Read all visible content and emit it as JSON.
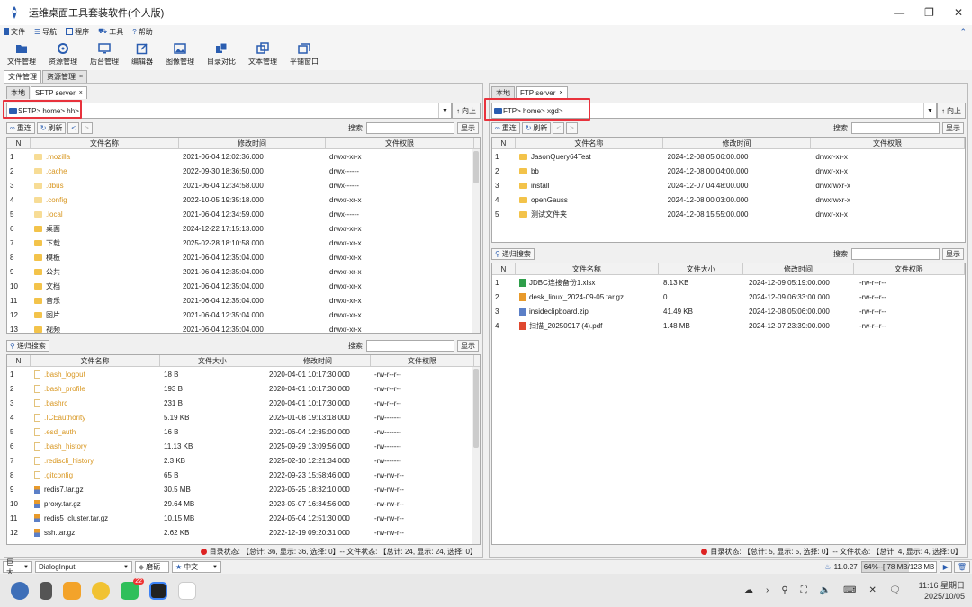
{
  "app": {
    "title": "运维桌面工具套装软件(个人版)",
    "brand_color": "#2a5db0"
  },
  "menu": [
    {
      "label": "文件",
      "icon": "file-icon"
    },
    {
      "label": "导航",
      "icon": "menu-icon"
    },
    {
      "label": "程序",
      "icon": "app-icon"
    },
    {
      "label": "工具",
      "icon": "tool-icon"
    },
    {
      "label": "帮助",
      "icon": "help-icon"
    }
  ],
  "toolbar": [
    {
      "label": "文件管理",
      "icon": "folder-open-icon"
    },
    {
      "label": "资源管理",
      "icon": "resource-icon"
    },
    {
      "label": "后台管理",
      "icon": "monitor-icon"
    },
    {
      "label": "编辑器",
      "icon": "edit-icon"
    },
    {
      "label": "图像管理",
      "icon": "image-icon"
    },
    {
      "label": "目录对比",
      "icon": "compare-icon"
    },
    {
      "label": "文本管理",
      "icon": "text-icon"
    },
    {
      "label": "平铺窗口",
      "icon": "tile-icon"
    }
  ],
  "main_tabs": [
    {
      "label": "文件管理",
      "active": true
    },
    {
      "label": "资源管理",
      "active": false,
      "close": "×"
    }
  ],
  "common": {
    "search": "搜索",
    "show": "显示",
    "up": "向上",
    "refresh_ctx": "重连",
    "refresh": "刷新",
    "recursive": "递归搜索",
    "col_n": "N",
    "col_name": "文件名称",
    "col_time": "修改时间",
    "col_perm": "文件权限",
    "col_size": "文件大小",
    "close": "×",
    "back": "<",
    "fwd": ">",
    "up_arrow": "↑",
    "dd_arrow": "▼"
  },
  "left": {
    "subtabs": [
      {
        "label": "本地"
      },
      {
        "label": "SFTP server",
        "close": "×"
      }
    ],
    "path": [
      "SFTP",
      "home",
      "hh"
    ],
    "dirs": [
      {
        "n": "1",
        "name": ".mozilla",
        "time": "2021-06-04 12:02:36.000",
        "perm": "drwxr-xr-x",
        "hidden": true
      },
      {
        "n": "2",
        "name": ".cache",
        "time": "2022-09-30 18:36:50.000",
        "perm": "drwx------",
        "hidden": true
      },
      {
        "n": "3",
        "name": ".dbus",
        "time": "2021-06-04 12:34:58.000",
        "perm": "drwx------",
        "hidden": true
      },
      {
        "n": "4",
        "name": ".config",
        "time": "2022-10-05 19:35:18.000",
        "perm": "drwxr-xr-x",
        "hidden": true
      },
      {
        "n": "5",
        "name": ".local",
        "time": "2021-06-04 12:34:59.000",
        "perm": "drwx------",
        "hidden": true
      },
      {
        "n": "6",
        "name": "桌面",
        "time": "2024-12-22 17:15:13.000",
        "perm": "drwxr-xr-x",
        "hidden": false
      },
      {
        "n": "7",
        "name": "下载",
        "time": "2025-02-28 18:10:58.000",
        "perm": "drwxr-xr-x",
        "hidden": false
      },
      {
        "n": "8",
        "name": "模板",
        "time": "2021-06-04 12:35:04.000",
        "perm": "drwxr-xr-x",
        "hidden": false
      },
      {
        "n": "9",
        "name": "公共",
        "time": "2021-06-04 12:35:04.000",
        "perm": "drwxr-xr-x",
        "hidden": false
      },
      {
        "n": "10",
        "name": "文档",
        "time": "2021-06-04 12:35:04.000",
        "perm": "drwxr-xr-x",
        "hidden": false
      },
      {
        "n": "11",
        "name": "音乐",
        "time": "2021-06-04 12:35:04.000",
        "perm": "drwxr-xr-x",
        "hidden": false
      },
      {
        "n": "12",
        "name": "图片",
        "time": "2021-06-04 12:35:04.000",
        "perm": "drwxr-xr-x",
        "hidden": false
      },
      {
        "n": "13",
        "name": "视频",
        "time": "2021-06-04 12:35:04.000",
        "perm": "drwxr-xr-x",
        "hidden": false
      }
    ],
    "files": [
      {
        "n": "1",
        "name": ".bash_logout",
        "size": "18 B",
        "time": "2020-04-01 10:17:30.000",
        "perm": "-rw-r--r--",
        "hidden": true
      },
      {
        "n": "2",
        "name": ".bash_profile",
        "size": "193 B",
        "time": "2020-04-01 10:17:30.000",
        "perm": "-rw-r--r--",
        "hidden": true
      },
      {
        "n": "3",
        "name": ".bashrc",
        "size": "231 B",
        "time": "2020-04-01 10:17:30.000",
        "perm": "-rw-r--r--",
        "hidden": true
      },
      {
        "n": "4",
        "name": ".ICEauthority",
        "size": "5.19 KB",
        "time": "2025-01-08 19:13:18.000",
        "perm": "-rw-------",
        "hidden": true
      },
      {
        "n": "5",
        "name": ".esd_auth",
        "size": "16 B",
        "time": "2021-06-04 12:35:00.000",
        "perm": "-rw-------",
        "hidden": true
      },
      {
        "n": "6",
        "name": ".bash_history",
        "size": "11.13 KB",
        "time": "2025-09-29 13:09:56.000",
        "perm": "-rw-------",
        "hidden": true
      },
      {
        "n": "7",
        "name": ".rediscli_history",
        "size": "2.3 KB",
        "time": "2025-02-10 12:21:34.000",
        "perm": "-rw-------",
        "hidden": true
      },
      {
        "n": "8",
        "name": ".gitconfig",
        "size": "65 B",
        "time": "2022-09-23 15:58:46.000",
        "perm": "-rw-rw-r--",
        "hidden": true
      },
      {
        "n": "9",
        "name": "redis7.tar.gz",
        "size": "30.5 MB",
        "time": "2023-05-25 18:32:10.000",
        "perm": "-rw-rw-r--",
        "hidden": false
      },
      {
        "n": "10",
        "name": "proxy.tar.gz",
        "size": "29.64 MB",
        "time": "2023-05-07 16:34:56.000",
        "perm": "-rw-rw-r--",
        "hidden": false
      },
      {
        "n": "11",
        "name": "redis5_cluster.tar.gz",
        "size": "10.15 MB",
        "time": "2024-05-04 12:51:30.000",
        "perm": "-rw-rw-r--",
        "hidden": false
      },
      {
        "n": "12",
        "name": "ssh.tar.gz",
        "size": "2.62 KB",
        "time": "2022-12-19 09:20:31.000",
        "perm": "-rw-rw-r--",
        "hidden": false
      }
    ],
    "status": "目录状态: 【总计: 36, 显示: 36, 选择: 0】-- 文件状态: 【总计: 24, 显示: 24, 选择: 0】"
  },
  "right": {
    "subtabs": [
      {
        "label": "本地"
      },
      {
        "label": "FTP server",
        "close": "×"
      }
    ],
    "path": [
      "FTP",
      "home",
      "xgd"
    ],
    "dirs": [
      {
        "n": "1",
        "name": "JasonQuery64Test",
        "time": "2024-12-08 05:06:00.000",
        "perm": "drwxr-xr-x"
      },
      {
        "n": "2",
        "name": "bb",
        "time": "2024-12-08 00:04:00.000",
        "perm": "drwxr-xr-x"
      },
      {
        "n": "3",
        "name": "install",
        "time": "2024-12-07 04:48:00.000",
        "perm": "drwxrwxr-x"
      },
      {
        "n": "4",
        "name": "openGauss",
        "time": "2024-12-08 00:03:00.000",
        "perm": "drwxrwxr-x"
      },
      {
        "n": "5",
        "name": "测试文件夹",
        "time": "2024-12-08 15:55:00.000",
        "perm": "drwxr-xr-x"
      }
    ],
    "files": [
      {
        "n": "1",
        "name": "JDBC连接备份1.xlsx",
        "size": "8.13 KB",
        "time": "2024-12-09 05:19:00.000",
        "perm": "-rw-r--r--",
        "icon": "xlsx-icon",
        "color": "#2e9e4a"
      },
      {
        "n": "2",
        "name": "desk_linux_2024-09-05.tar.gz",
        "size": "0",
        "time": "2024-12-09 06:33:00.000",
        "perm": "-rw-r--r--",
        "icon": "archive-icon",
        "color": "#e89a2b"
      },
      {
        "n": "3",
        "name": "insideclipboard.zip",
        "size": "41.49 KB",
        "time": "2024-12-08 05:06:00.000",
        "perm": "-rw-r--r--",
        "icon": "zip-icon",
        "color": "#5b7fc7"
      },
      {
        "n": "4",
        "name": "扫描_20250917 (4).pdf",
        "size": "1.48 MB",
        "time": "2024-12-07 23:39:00.000",
        "perm": "-rw-r--r--",
        "icon": "pdf-icon",
        "color": "#e0482f"
      }
    ],
    "status": "目录状态: 【总计: 5, 显示: 5, 选择: 0】-- 文件状态: 【总计: 4, 显示: 4, 选择: 0】"
  },
  "bottom": {
    "size": "巨大",
    "font": "DialogInput",
    "style": "磨砺",
    "lang": "中文",
    "version": "11.0.27",
    "memory": "64%--[ 78 MB/123 MB ]"
  },
  "taskbar": {
    "time": "11:16 星期日",
    "date": "2025/10/05",
    "badge": "22"
  }
}
